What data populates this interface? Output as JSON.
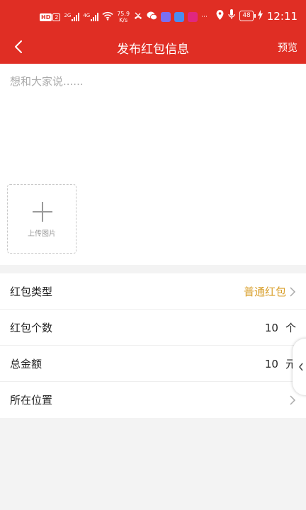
{
  "status_bar": {
    "hd_label": "HD",
    "hd_sim": "2",
    "net1": "2G",
    "net2": "4G",
    "speed_value": "75.9",
    "speed_unit": "K/s",
    "battery": "48",
    "time": "12:11"
  },
  "header": {
    "title": "发布红包信息",
    "preview_label": "预览",
    "back_icon": "chevron-left-icon"
  },
  "compose": {
    "placeholder": "想和大家说......",
    "upload_label": "上传图片",
    "upload_icon": "plus-icon"
  },
  "form": {
    "rows": [
      {
        "label": "红包类型",
        "value": "普通红包"
      },
      {
        "label": "红包个数",
        "value": "10",
        "unit": "个"
      },
      {
        "label": "总金额",
        "value": "10",
        "unit": "元"
      },
      {
        "label": "所在位置",
        "value": ""
      }
    ]
  },
  "colors": {
    "brand_red": "#e02e24",
    "accent_orange": "#d9a02d",
    "page_bg": "#f3f3f3"
  }
}
